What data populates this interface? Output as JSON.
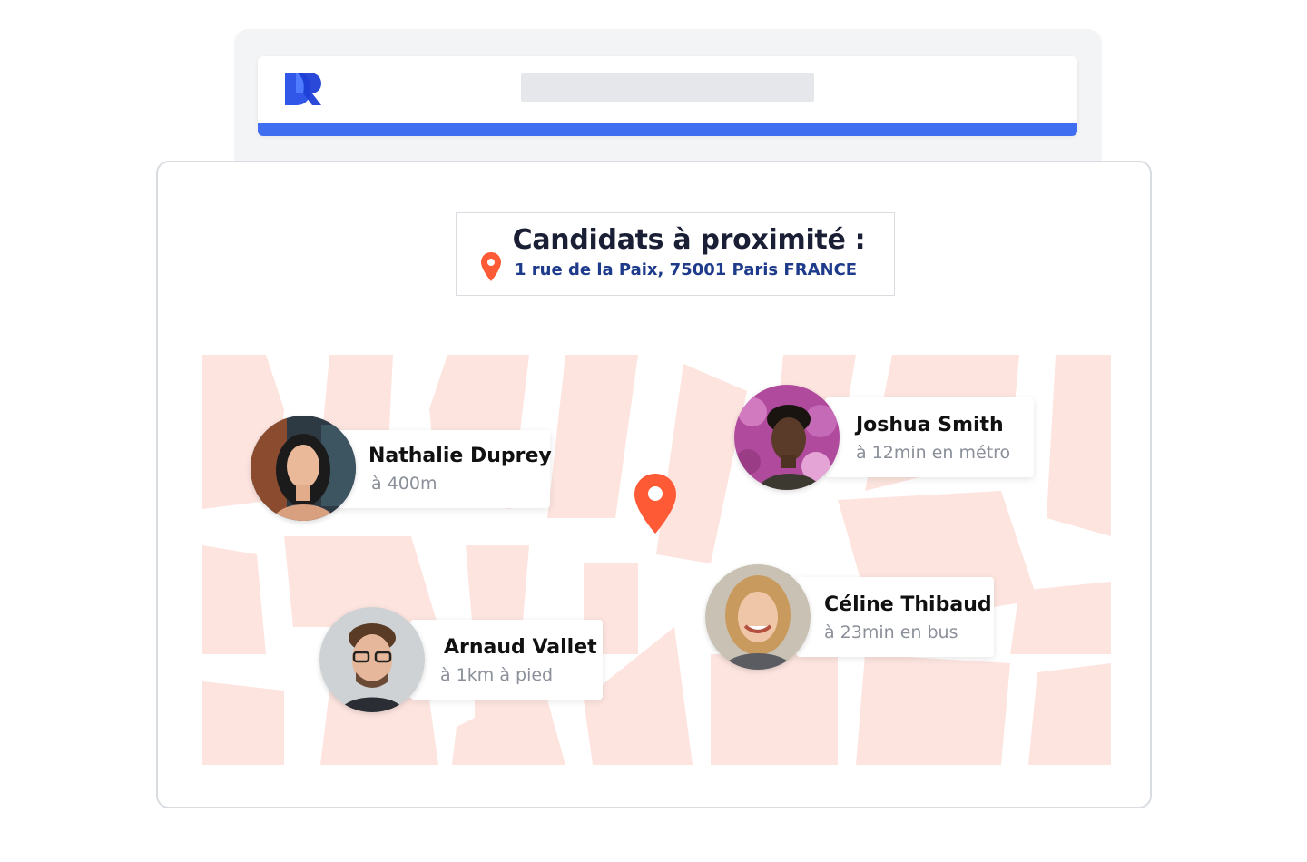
{
  "header": {
    "logo_icon": "dr-logo-icon",
    "accent_color": "#3f6ff0"
  },
  "location": {
    "title": "Candidats à proximité :",
    "address": "1 rue de la Paix, 75001 Paris FRANCE",
    "pin_icon": "map-pin-icon",
    "pin_color": "#ff5a36"
  },
  "map": {
    "block_color": "#fde4df",
    "road_color": "#ffffff"
  },
  "candidates": [
    {
      "name": "Nathalie Duprey",
      "distance": "à 400m",
      "avatar": "avatar-photo"
    },
    {
      "name": "Joshua Smith",
      "distance": "à 12min en métro",
      "avatar": "avatar-photo"
    },
    {
      "name": "Céline Thibaud",
      "distance": "à 23min en bus",
      "avatar": "avatar-photo"
    },
    {
      "name": "Arnaud Vallet",
      "distance": "à 1km à pied",
      "avatar": "avatar-photo"
    }
  ]
}
